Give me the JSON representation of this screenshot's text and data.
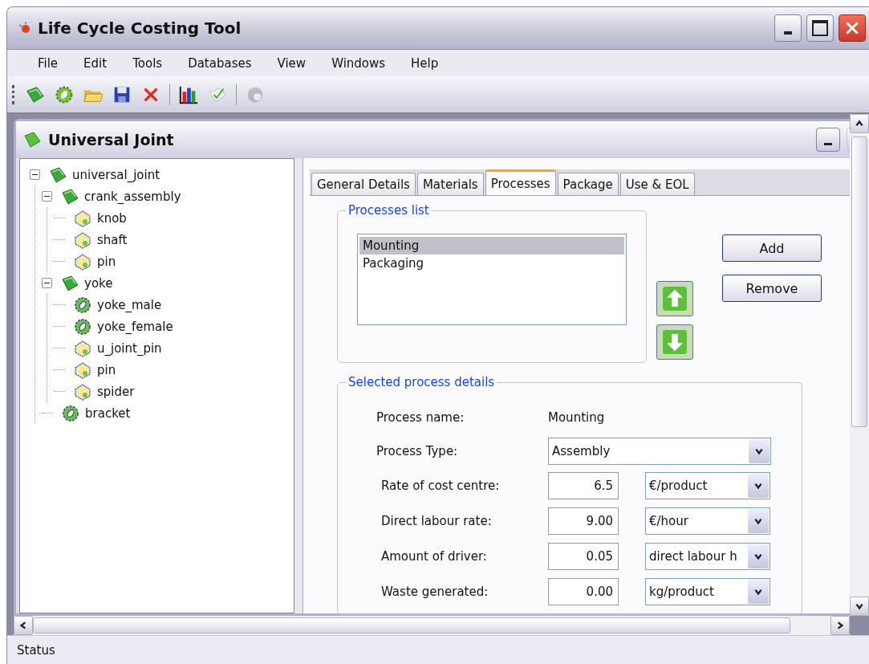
{
  "window": {
    "title": "Life Cycle Costing Tool"
  },
  "menu": [
    "File",
    "Edit",
    "Tools",
    "Databases",
    "View",
    "Windows",
    "Help"
  ],
  "toolbar_groups": [
    {
      "tools": [
        {
          "kind": "book",
          "disabled": false
        },
        {
          "kind": "gear",
          "disabled": false
        },
        {
          "kind": "folder",
          "disabled": false
        },
        {
          "kind": "save",
          "disabled": false
        },
        {
          "kind": "delete",
          "disabled": false
        }
      ]
    },
    {
      "tools": [
        {
          "kind": "chart",
          "disabled": false
        },
        {
          "kind": "check",
          "disabled": false
        }
      ]
    },
    {
      "tools": [
        {
          "kind": "help",
          "disabled": true
        }
      ]
    }
  ],
  "document": {
    "title": "Universal Joint",
    "tree": [
      {
        "label": "universal_joint",
        "kind": "assembly",
        "expanded": true,
        "children": [
          {
            "label": "crank_assembly",
            "kind": "assembly",
            "expanded": true,
            "children": [
              {
                "label": "knob",
                "kind": "part"
              },
              {
                "label": "shaft",
                "kind": "part"
              },
              {
                "label": "pin",
                "kind": "part"
              }
            ]
          },
          {
            "label": "yoke",
            "kind": "assembly",
            "expanded": true,
            "children": [
              {
                "label": "yoke_male",
                "kind": "component"
              },
              {
                "label": "yoke_female",
                "kind": "component"
              },
              {
                "label": "u_joint_pin",
                "kind": "part"
              },
              {
                "label": "pin",
                "kind": "part"
              },
              {
                "label": "spider",
                "kind": "part"
              }
            ]
          },
          {
            "label": "bracket",
            "kind": "component"
          }
        ]
      }
    ],
    "tabs": [
      {
        "label": "General Details",
        "selected": false
      },
      {
        "label": "Materials",
        "selected": false
      },
      {
        "label": "Processes",
        "selected": true
      },
      {
        "label": "Package",
        "selected": false
      },
      {
        "label": "Use & EOL",
        "selected": false
      }
    ],
    "processes_list": {
      "legend": "Processes list",
      "items": [
        {
          "label": "Mounting",
          "selected": true
        },
        {
          "label": "Packaging",
          "selected": false
        }
      ]
    },
    "buttons": [
      "Add",
      "Remove"
    ],
    "details": {
      "legend": "Selected process details",
      "process_name_label": "Process name:",
      "process_name": "Mounting",
      "process_type_label": "Process Type:",
      "process_type": "Assembly",
      "rows": [
        {
          "label": "Rate of cost centre:",
          "value": "6.5",
          "unit": "€/product"
        },
        {
          "label": "Direct labour rate:",
          "value": "9.00",
          "unit": "€/hour"
        },
        {
          "label": "Amount of driver:",
          "value": "0.05",
          "unit": "direct labour h"
        },
        {
          "label": "Waste generated:",
          "value": "0.00",
          "unit": "kg/product"
        }
      ]
    }
  },
  "status_bar": "Status"
}
